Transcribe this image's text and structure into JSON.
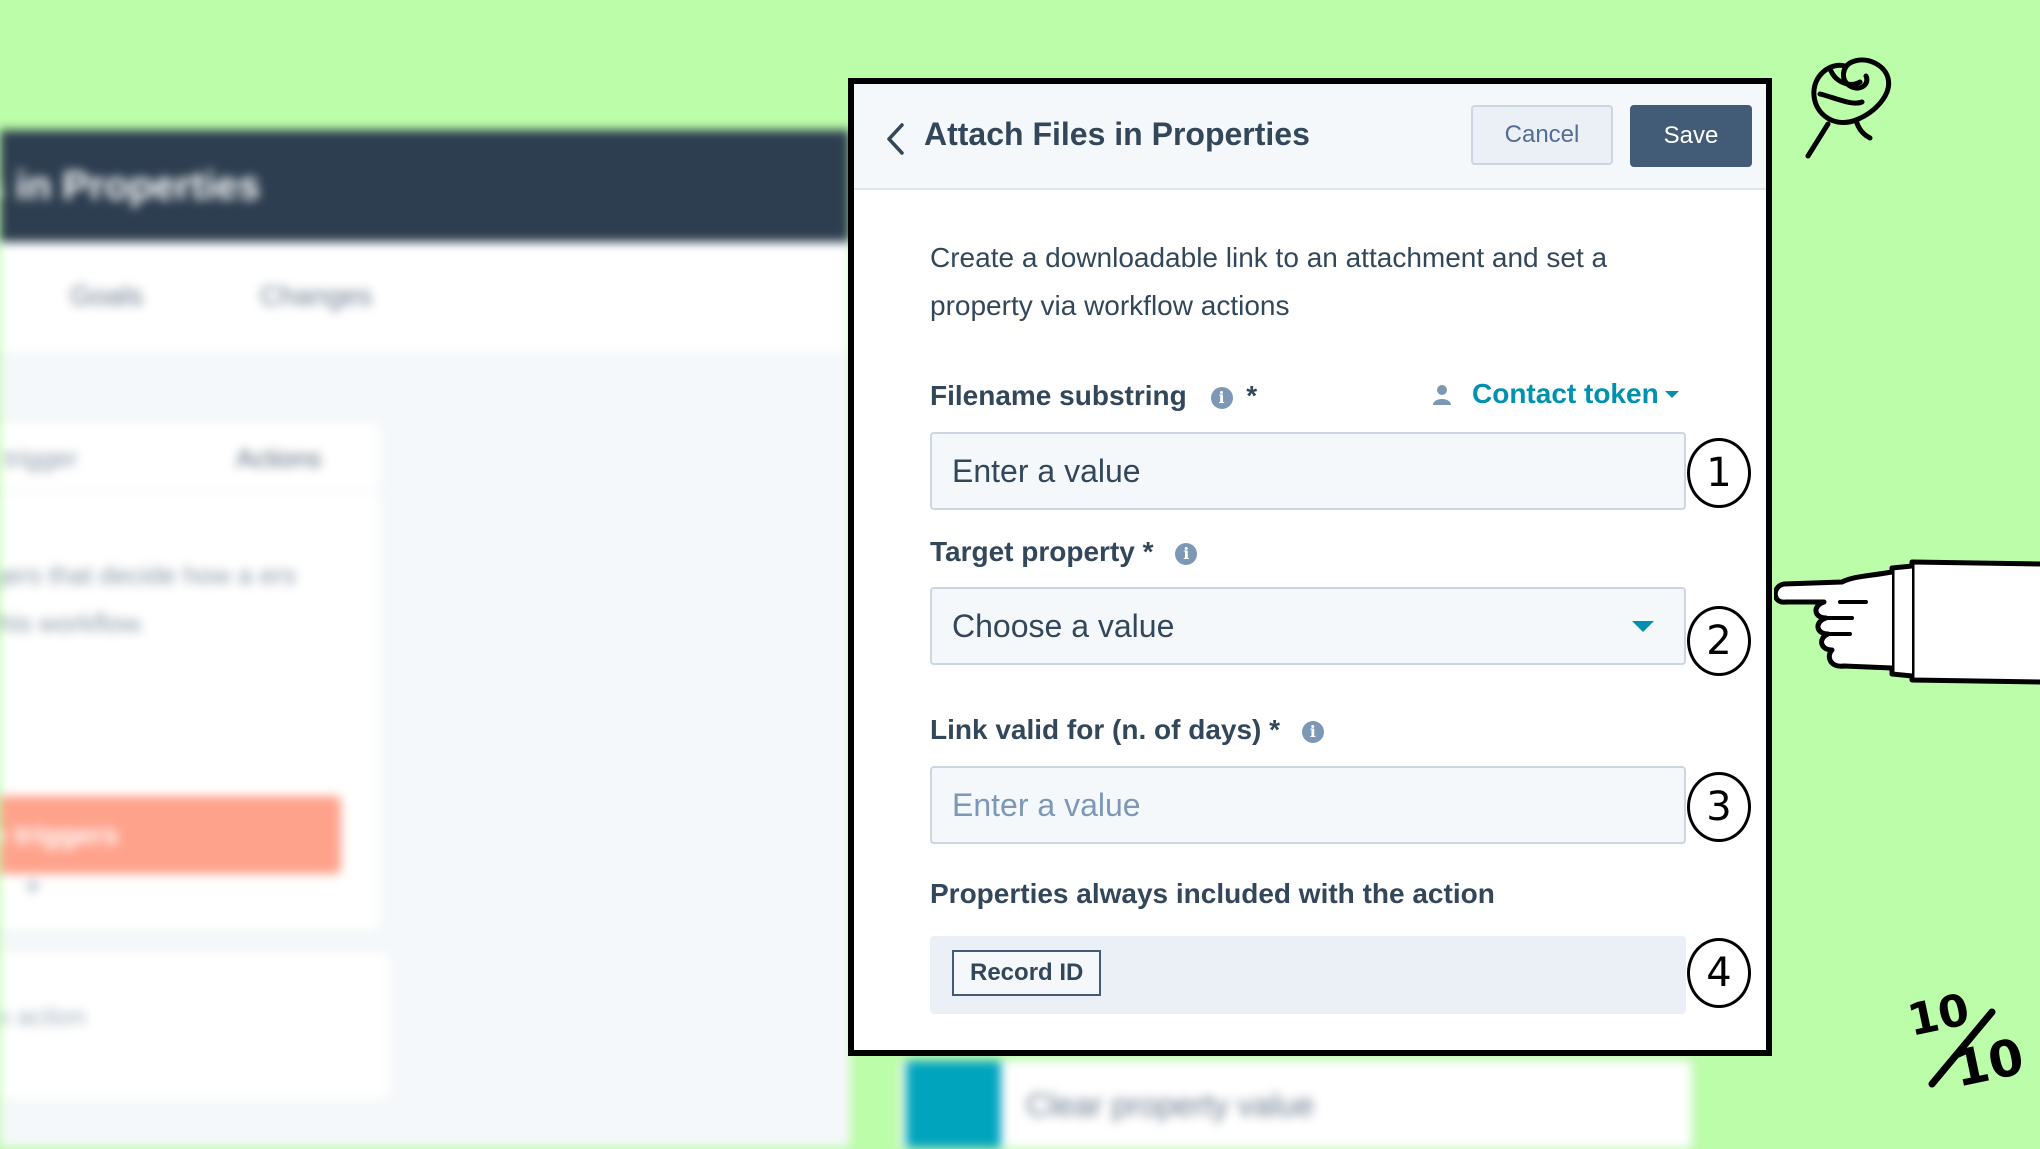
{
  "background": {
    "header_title": "es in Properties",
    "tabs": [
      "Goals",
      "Changes"
    ],
    "card_header_left": "l trigger",
    "card_header_right": "Actions",
    "card_text": "gers that decide how a ers this workflow.",
    "card_button": "e triggers",
    "card2_text": "w action",
    "bottom_action": "Clear property value"
  },
  "panel": {
    "title": "Attach Files in Properties",
    "cancel_label": "Cancel",
    "save_label": "Save",
    "description": "Create a downloadable link to an attachment and set a property via workflow actions"
  },
  "fields": {
    "filename": {
      "label": "Filename substring",
      "required": "*",
      "token_label": "Contact token",
      "value": "Enter a value"
    },
    "target": {
      "label": "Target property *",
      "value": "Choose a value"
    },
    "link_valid": {
      "label": "Link valid for (n. of days) *",
      "placeholder": "Enter a value"
    },
    "included": {
      "label": "Properties always included with the action",
      "tag": "Record ID"
    }
  },
  "annotations": {
    "badges": [
      "1",
      "2",
      "3",
      "4"
    ],
    "score_top": "10",
    "score_bottom": "10"
  },
  "colors": {
    "page_background": "#bbfda8",
    "header_dark": "#2d3e50",
    "save_button": "#425b76",
    "link_accent": "#0091ae",
    "trigger_button": "#ffa28c"
  },
  "icons": {
    "back": "chevron-left-icon",
    "info": "info-icon",
    "person": "person-icon",
    "dropdown": "caret-down-icon",
    "rose": "rose-doodle-icon",
    "pointing_hand": "pointing-hand-icon"
  }
}
